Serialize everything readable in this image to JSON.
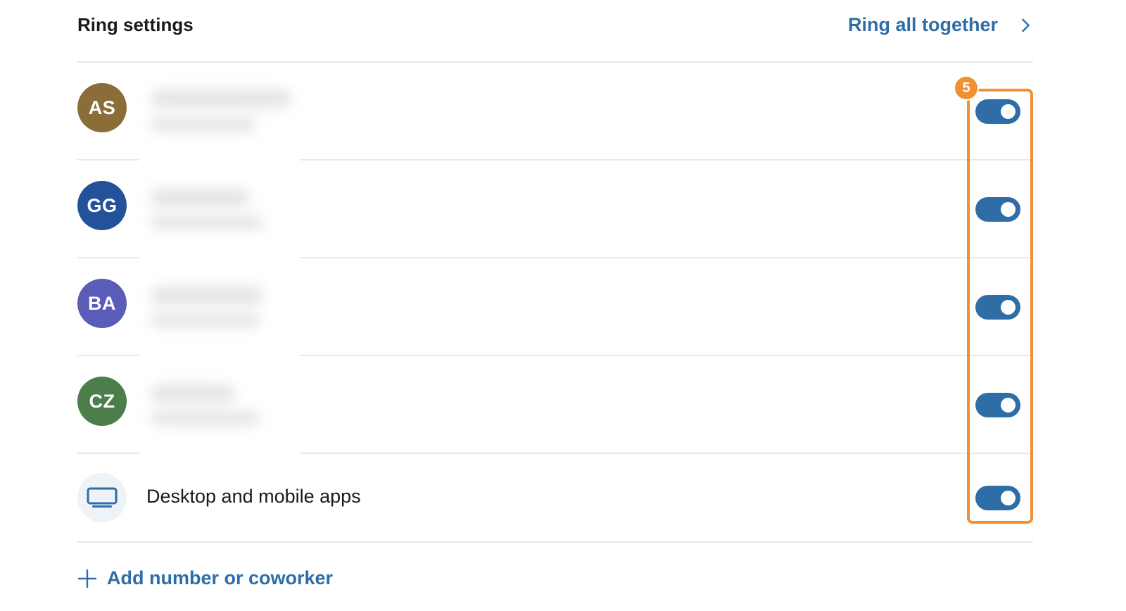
{
  "header": {
    "title": "Ring settings",
    "ring_all_label": "Ring all together",
    "ring_all_icon": "chevron-right-icon"
  },
  "members": [
    {
      "initials": "AS",
      "avatar_color": "#8a6d38",
      "name_redacted": true,
      "enabled": true
    },
    {
      "initials": "GG",
      "avatar_color": "#23529a",
      "name_redacted": true,
      "enabled": true
    },
    {
      "initials": "BA",
      "avatar_color": "#5b5bb8",
      "name_redacted": true,
      "enabled": true
    },
    {
      "initials": "CZ",
      "avatar_color": "#4e7d4c",
      "name_redacted": true,
      "enabled": true
    }
  ],
  "device": {
    "icon": "monitor-icon",
    "label": "Desktop and mobile apps",
    "enabled": true
  },
  "add": {
    "icon": "plus-icon",
    "label": "Add number or coworker"
  },
  "annotation": {
    "badge_number": "5",
    "color": "#ef9033"
  },
  "colors": {
    "accent": "#2f6da7",
    "divider": "#e8e8e8",
    "toggle_on": "#2f6da7"
  }
}
